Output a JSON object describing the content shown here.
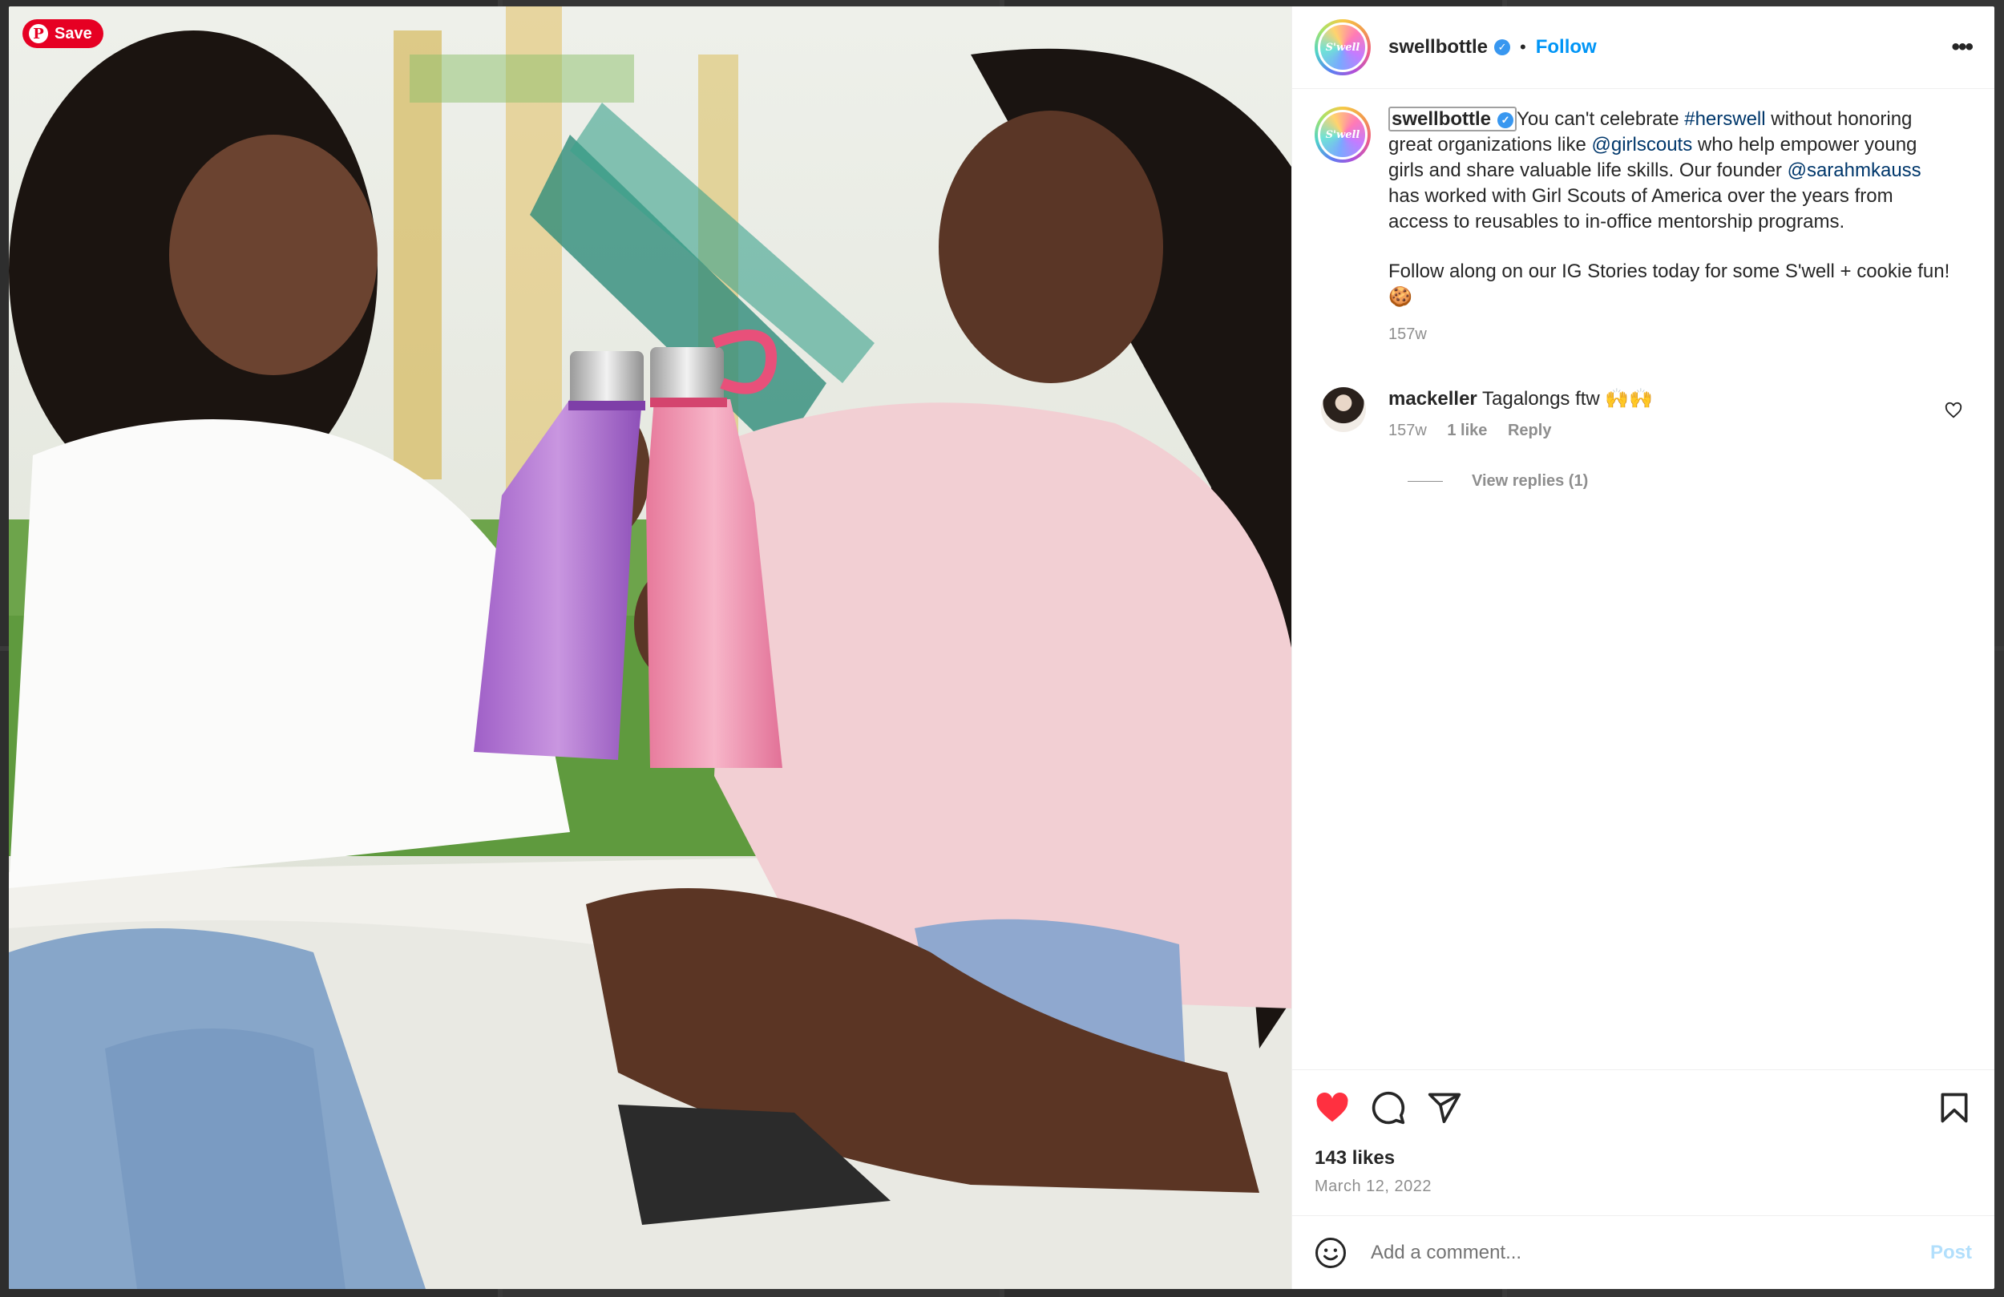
{
  "pin": {
    "save_label": "Save"
  },
  "post": {
    "account": "swellbottle",
    "avatar_text": "S'well",
    "follow_label": "Follow",
    "more_label": "•••",
    "caption": {
      "part1": "You can't celebrate ",
      "hashtag": "#herswell",
      "part2": " without honoring great organizations like ",
      "mention1": "@girlscouts",
      "part3": " who help empower young girls and share valuable life skills. Our founder ",
      "mention2": "@sarahmkauss",
      "part4": " has worked with Girl Scouts of America over the years from access to reusables to in-office mentorship programs.",
      "paragraph2": "Follow along on our IG Stories today for some S'well + cookie fun! 🍪",
      "age": "157w"
    },
    "comment": {
      "user": "mackeller",
      "text": "Tagalongs ftw 🙌🙌",
      "age": "157w",
      "likes": "1 like",
      "reply_label": "Reply",
      "view_replies": "View replies (1)"
    },
    "likes": "143 likes",
    "date": "March 12, 2022",
    "liked": true,
    "accent_color": "#0095f6",
    "like_color": "#ff3040"
  },
  "composer": {
    "placeholder": "Add a comment...",
    "post_label": "Post"
  },
  "icons": [
    "pinterest-icon",
    "verified-icon",
    "more-icon",
    "heart-icon",
    "comment-icon",
    "share-icon",
    "bookmark-icon",
    "emoji-icon"
  ]
}
